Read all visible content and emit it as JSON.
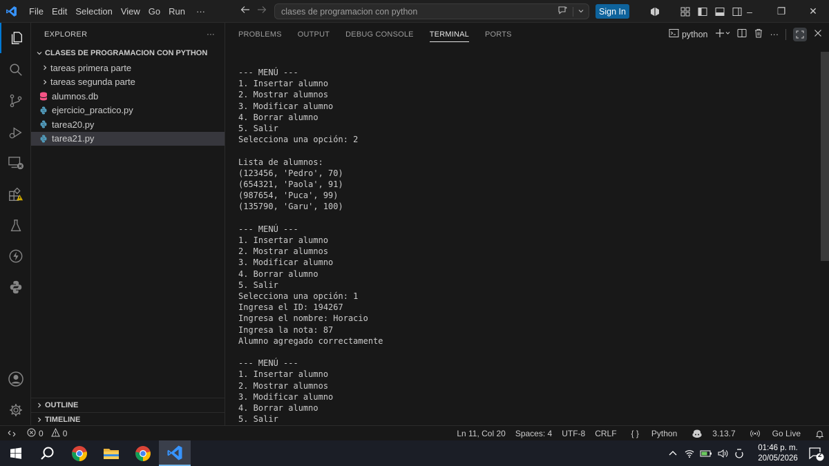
{
  "titlebar": {
    "menu": [
      "File",
      "Edit",
      "Selection",
      "View",
      "Go",
      "Run"
    ],
    "more": "···",
    "search_text": "clases de programacion con python",
    "sign_in": "Sign In"
  },
  "sidebar": {
    "header": "EXPLORER",
    "more": "···",
    "folder": "CLASES DE PROGRAMACION CON PYTHON",
    "items": [
      {
        "label": "tareas primera parte",
        "type": "folder"
      },
      {
        "label": "tareas segunda parte",
        "type": "folder"
      },
      {
        "label": "alumnos.db",
        "type": "db"
      },
      {
        "label": "ejercicio_practico.py",
        "type": "python"
      },
      {
        "label": "tarea20.py",
        "type": "python"
      },
      {
        "label": "tarea21.py",
        "type": "python",
        "selected": true
      }
    ],
    "outline": "OUTLINE",
    "timeline": "TIMELINE"
  },
  "panel": {
    "tabs": [
      "PROBLEMS",
      "OUTPUT",
      "DEBUG CONSOLE",
      "TERMINAL",
      "PORTS"
    ],
    "active_tab": "TERMINAL",
    "terminal_name": "python"
  },
  "terminal": {
    "lines": [
      "--- MENÚ ---",
      "1. Insertar alumno",
      "2. Mostrar alumnos",
      "3. Modificar alumno",
      "4. Borrar alumno",
      "5. Salir",
      "Selecciona una opción: 2",
      "",
      "Lista de alumnos:",
      "(123456, 'Pedro', 70)",
      "(654321, 'Paola', 91)",
      "(987654, 'Puca', 99)",
      "(135790, 'Garu', 100)",
      "",
      "--- MENÚ ---",
      "1. Insertar alumno",
      "2. Mostrar alumnos",
      "3. Modificar alumno",
      "4. Borrar alumno",
      "5. Salir",
      "Selecciona una opción: 1",
      "Ingresa el ID: 194267",
      "Ingresa el nombre: Horacio",
      "Ingresa la nota: 87",
      "Alumno agregado correctamente",
      "",
      "--- MENÚ ---",
      "1. Insertar alumno",
      "2. Mostrar alumnos",
      "3. Modificar alumno",
      "4. Borrar alumno",
      "5. Salir"
    ]
  },
  "statusbar": {
    "errors": "0",
    "warnings": "0",
    "position": "Ln 11, Col 20",
    "spaces": "Spaces: 4",
    "encoding": "UTF-8",
    "eol": "CRLF",
    "language": "Python",
    "python_version": "3.13.7",
    "go_live": "Go Live"
  },
  "taskbar": {
    "time": "01:46 p. m.",
    "date": "20/05/2026",
    "notifications": "2"
  },
  "colors": {
    "accent": "#0078d4",
    "signin": "#0e639c",
    "python_icon": "#519aba",
    "db_icon": "#f55385"
  }
}
